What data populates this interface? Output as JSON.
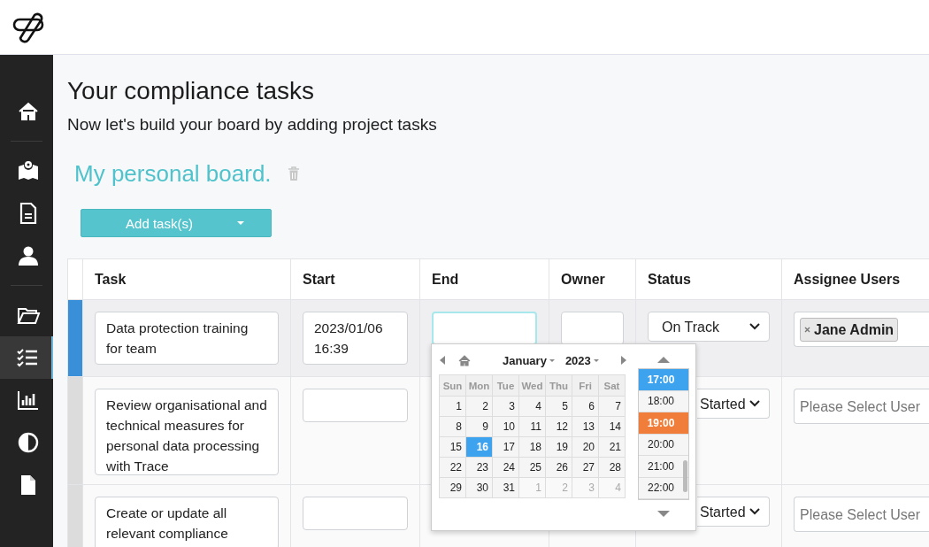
{
  "sidebar": {
    "items": [
      {
        "kind": "home",
        "selected": false
      },
      {
        "kind": "divider"
      },
      {
        "kind": "map",
        "selected": false
      },
      {
        "kind": "document",
        "selected": false
      },
      {
        "kind": "user",
        "selected": false
      },
      {
        "kind": "divider"
      },
      {
        "kind": "folder",
        "selected": false
      },
      {
        "kind": "tasks",
        "selected": true
      },
      {
        "kind": "chart",
        "selected": false
      },
      {
        "kind": "contrast",
        "selected": false
      },
      {
        "kind": "file",
        "selected": false
      }
    ]
  },
  "page": {
    "title": "Your compliance tasks",
    "subtitle": "Now let's build your board by adding project tasks"
  },
  "board": {
    "title": "My personal board.",
    "add_button": "Add task(s)"
  },
  "table": {
    "columns": [
      "Task",
      "Start",
      "End",
      "Owner",
      "Status",
      "Assignee Users"
    ],
    "rows": [
      {
        "selected": true,
        "task": "Data protection training for team",
        "start": "2023/01/06 16:39",
        "end": {
          "focused": true
        },
        "owner": {
          "focused": false
        },
        "status": "On Track",
        "assignees": [
          "Jane Admin"
        ]
      },
      {
        "selected": false,
        "task": "Review organisational and technical measures for personal data processing with Trace",
        "status": "Started",
        "assignee_placeholder": "Please Select User"
      },
      {
        "selected": false,
        "task": "Create or update all relevant compliance",
        "status": "Started",
        "assignee_placeholder": "Please Select User"
      }
    ]
  },
  "datepicker": {
    "month": "January",
    "year": "2023",
    "weekdays": [
      "Sun",
      "Mon",
      "Tue",
      "Wed",
      "Thu",
      "Fri",
      "Sat"
    ],
    "weeks": [
      [
        {
          "label": "1",
          "muted": false,
          "selected": false
        },
        {
          "label": "2",
          "muted": false,
          "selected": false
        },
        {
          "label": "3",
          "muted": false,
          "selected": false
        },
        {
          "label": "4",
          "muted": false,
          "selected": false
        },
        {
          "label": "5",
          "muted": false,
          "selected": false
        },
        {
          "label": "6",
          "muted": false,
          "selected": false
        },
        {
          "label": "7",
          "muted": false,
          "selected": false
        }
      ],
      [
        {
          "label": "8",
          "muted": false,
          "selected": false
        },
        {
          "label": "9",
          "muted": false,
          "selected": false
        },
        {
          "label": "10",
          "muted": false,
          "selected": false
        },
        {
          "label": "11",
          "muted": false,
          "selected": false
        },
        {
          "label": "12",
          "muted": false,
          "selected": false
        },
        {
          "label": "13",
          "muted": false,
          "selected": false
        },
        {
          "label": "14",
          "muted": false,
          "selected": false
        }
      ],
      [
        {
          "label": "15",
          "muted": false,
          "selected": false
        },
        {
          "label": "16",
          "muted": false,
          "selected": true
        },
        {
          "label": "17",
          "muted": false,
          "selected": false
        },
        {
          "label": "18",
          "muted": false,
          "selected": false
        },
        {
          "label": "19",
          "muted": false,
          "selected": false
        },
        {
          "label": "20",
          "muted": false,
          "selected": false
        },
        {
          "label": "21",
          "muted": false,
          "selected": false
        }
      ],
      [
        {
          "label": "22",
          "muted": false,
          "selected": false
        },
        {
          "label": "23",
          "muted": false,
          "selected": false
        },
        {
          "label": "24",
          "muted": false,
          "selected": false
        },
        {
          "label": "25",
          "muted": false,
          "selected": false
        },
        {
          "label": "26",
          "muted": false,
          "selected": false
        },
        {
          "label": "27",
          "muted": false,
          "selected": false
        },
        {
          "label": "28",
          "muted": false,
          "selected": false
        }
      ],
      [
        {
          "label": "29",
          "muted": false,
          "selected": false
        },
        {
          "label": "30",
          "muted": false,
          "selected": false
        },
        {
          "label": "31",
          "muted": false,
          "selected": false
        },
        {
          "label": "1",
          "muted": true,
          "selected": false
        },
        {
          "label": "2",
          "muted": true,
          "selected": false
        },
        {
          "label": "3",
          "muted": true,
          "selected": false
        },
        {
          "label": "4",
          "muted": true,
          "selected": false
        }
      ]
    ],
    "times": [
      {
        "label": "17:00",
        "selected": true,
        "current": false
      },
      {
        "label": "18:00",
        "selected": false,
        "current": false
      },
      {
        "label": "19:00",
        "selected": false,
        "current": true
      },
      {
        "label": "20:00",
        "selected": false,
        "current": false
      },
      {
        "label": "21:00",
        "selected": false,
        "current": false
      },
      {
        "label": "22:00",
        "selected": false,
        "current": false
      }
    ]
  }
}
